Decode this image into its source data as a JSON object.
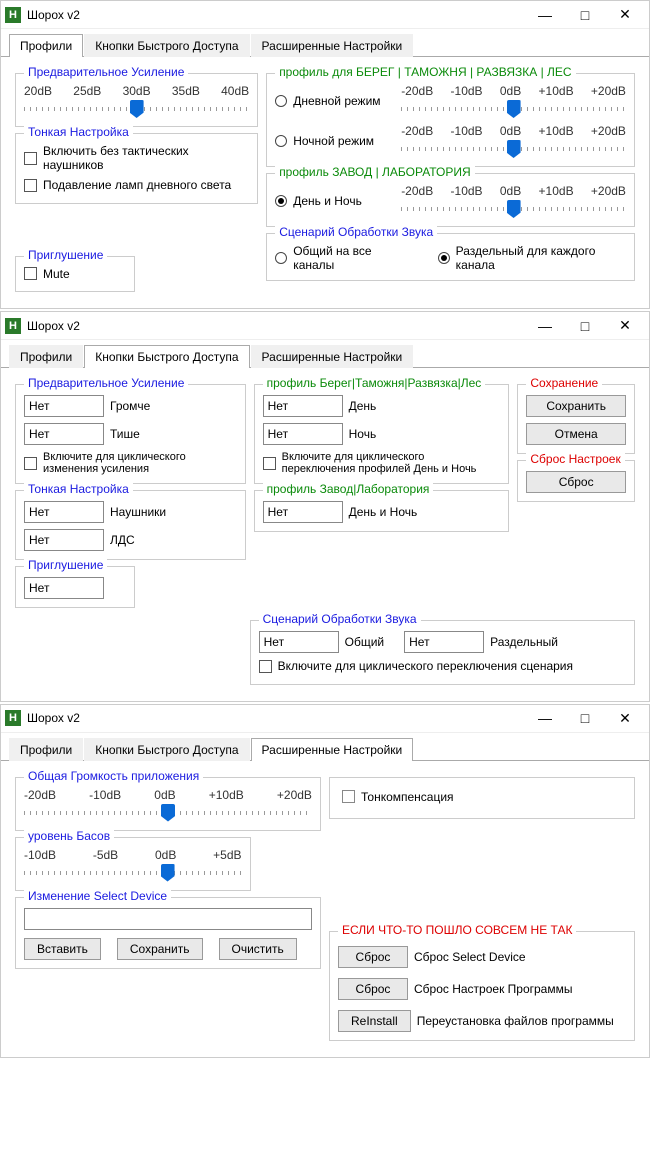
{
  "appTitle": "Шорох v2",
  "iconLetter": "H",
  "winBtns": {
    "min": "—",
    "max": "□",
    "close": "✕"
  },
  "tabs": {
    "profiles": "Профили",
    "quick": "Кнопки Быстрого Доступа",
    "adv": "Расширенные Настройки"
  },
  "w1": {
    "preamp": {
      "title": "Предварительное Усиление",
      "ticks": [
        "20dB",
        "25dB",
        "30dB",
        "35dB",
        "40dB"
      ]
    },
    "fine": {
      "title": "Тонкая Настройка",
      "chk1": "Включить без тактических наушников",
      "chk2": "Подавление ламп дневного света"
    },
    "mute": {
      "title": "Приглушение",
      "label": "Mute"
    },
    "profBereg": {
      "title": "профиль для БЕРЕГ | ТАМОЖНЯ | РАЗВЯЗКА | ЛЕС",
      "dayLabel": "Дневной режим",
      "nightLabel": "Ночной режим",
      "ticks": [
        "-20dB",
        "-10dB",
        "0dB",
        "+10dB",
        "+20dB"
      ]
    },
    "profZavod": {
      "title": "профиль ЗАВОД | ЛАБОРАТОРИЯ",
      "both": "День и Ночь",
      "ticks": [
        "-20dB",
        "-10dB",
        "0dB",
        "+10dB",
        "+20dB"
      ]
    },
    "scenario": {
      "title": "Сценарий Обработки Звука",
      "all": "Общий на все каналы",
      "sep": "Раздельный для каждого канала"
    }
  },
  "w2": {
    "preamp": {
      "title": "Предварительное Усиление",
      "none": "Нет",
      "louder": "Громче",
      "quieter": "Тише",
      "cyc": "Включите для циклического изменения усиления"
    },
    "fine": {
      "title": "Тонкая Настройка",
      "none": "Нет",
      "head": "Наушники",
      "lds": "ЛДС"
    },
    "muteTitle": "Приглушение",
    "muteVal": "Нет",
    "bereg": {
      "title": "профиль Берег|Таможня|Развязка|Лес",
      "none": "Нет",
      "day": "День",
      "night": "Ночь",
      "cyc": "Включите для циклического переключения профилей День и Ночь"
    },
    "zavod": {
      "title": "профиль Завод|Лаборатория",
      "none": "Нет",
      "both": "День и Ночь"
    },
    "scenario": {
      "title": "Сценарий Обработки Звука",
      "none": "Нет",
      "all": "Общий",
      "sep": "Раздельный",
      "cyc": "Включите для циклического переключения сценария"
    },
    "save": {
      "title": "Сохранение",
      "save": "Сохранить",
      "cancel": "Отмена"
    },
    "reset": {
      "title": "Сброс Настроек",
      "btn": "Сброс"
    }
  },
  "w3": {
    "volume": {
      "title": "Общая Громкость приложения",
      "ticks": [
        "-20dB",
        "-10dB",
        "0dB",
        "+10dB",
        "+20dB"
      ]
    },
    "bass": {
      "title": "уровень Басов",
      "ticks": [
        "-10dB",
        "-5dB",
        "0dB",
        "+5dB"
      ]
    },
    "tone": "Тонкомпенсация",
    "device": {
      "title": "Изменение Select Device",
      "paste": "Вставить",
      "save": "Сохранить",
      "clear": "Очистить"
    },
    "panic": {
      "title": "ЕСЛИ ЧТО-ТО ПОШЛО СОВСЕМ НЕ ТАК",
      "reset": "Сброс",
      "reinstall": "ReInstall",
      "r1": "Сброс Select Device",
      "r2": "Сброс Настроек Программы",
      "r3": "Переустановка файлов программы"
    }
  }
}
